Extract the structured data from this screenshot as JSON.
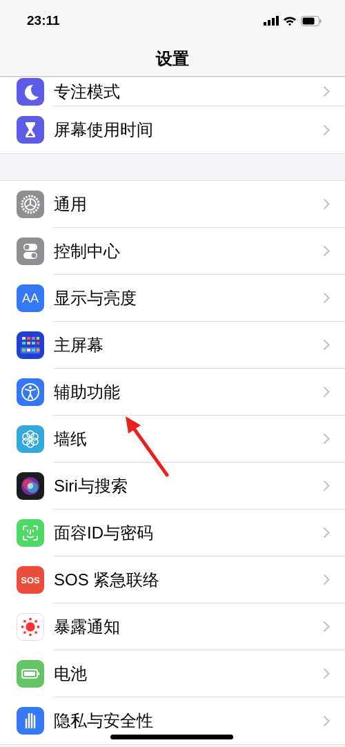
{
  "status_bar": {
    "time": "23:11"
  },
  "nav_bar": {
    "title": "设置"
  },
  "groups": [
    {
      "items": [
        {
          "kind": "focus",
          "label": "专注模式"
        },
        {
          "kind": "screen-time",
          "label": "屏幕使用时间"
        }
      ]
    },
    {
      "items": [
        {
          "kind": "general",
          "label": "通用"
        },
        {
          "kind": "control-center",
          "label": "控制中心"
        },
        {
          "kind": "display",
          "label": "显示与亮度",
          "icon_text": "AA"
        },
        {
          "kind": "home-screen",
          "label": "主屏幕"
        },
        {
          "kind": "accessibility",
          "label": "辅助功能"
        },
        {
          "kind": "wallpaper",
          "label": "墙纸"
        },
        {
          "kind": "siri",
          "label": "Siri与搜索"
        },
        {
          "kind": "face-id",
          "label": "面容ID与密码"
        },
        {
          "kind": "sos",
          "label": "SOS 紧急联络",
          "icon_text": "SOS"
        },
        {
          "kind": "exposure",
          "label": "暴露通知"
        },
        {
          "kind": "battery",
          "label": "电池"
        },
        {
          "kind": "privacy",
          "label": "隐私与安全性"
        }
      ]
    }
  ]
}
